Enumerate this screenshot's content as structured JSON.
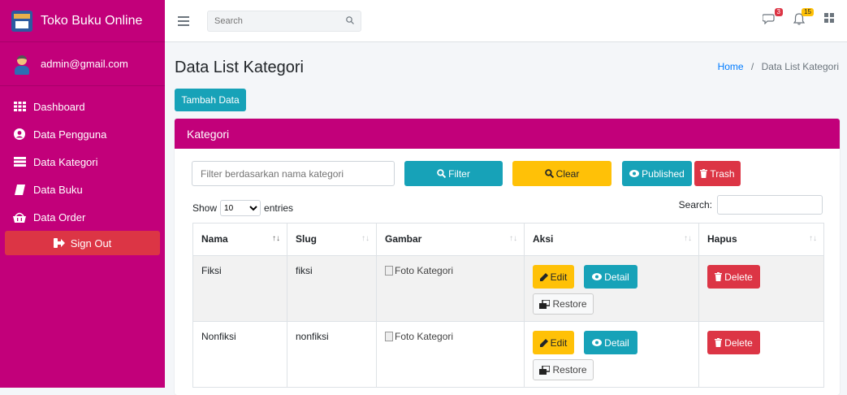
{
  "brand": {
    "name": "Toko Buku Online"
  },
  "user": {
    "email": "admin@gmail.com"
  },
  "sidebar": {
    "items": [
      {
        "label": "Dashboard",
        "icon": "grid-icon"
      },
      {
        "label": "Data Pengguna",
        "icon": "user-circle-icon"
      },
      {
        "label": "Data Kategori",
        "icon": "list-icon"
      },
      {
        "label": "Data Buku",
        "icon": "book-icon"
      },
      {
        "label": "Data Order",
        "icon": "cart-icon"
      }
    ],
    "signout_label": "Sign Out"
  },
  "topbar": {
    "search_placeholder": "Search",
    "messages_badge": "3",
    "notifications_badge": "15"
  },
  "page": {
    "title": "Data List Kategori",
    "breadcrumb": {
      "home": "Home",
      "separator": "/",
      "current": "Data List Kategori"
    },
    "add_button": "Tambah Data"
  },
  "card": {
    "title": "Kategori",
    "filter_placeholder": "Filter berdasarkan nama kategori",
    "filter_button": "Filter",
    "clear_button": "Clear",
    "published_button": "Published",
    "trash_button": "Trash",
    "show_label": "Show",
    "entries_value": "10",
    "entries_label": "entries",
    "search_label": "Search:"
  },
  "table": {
    "columns": [
      "Nama",
      "Slug",
      "Gambar",
      "Aksi",
      "Hapus"
    ],
    "rows": [
      {
        "nama": "Fiksi",
        "slug": "fiksi",
        "gambar_alt": "Foto Kategori"
      },
      {
        "nama": "Nonfiksi",
        "slug": "nonfiksi",
        "gambar_alt": "Foto Kategori"
      }
    ],
    "edit_label": "Edit",
    "detail_label": "Detail",
    "restore_label": "Restore",
    "delete_label": "Delete"
  },
  "colors": {
    "brand": "#c2007a",
    "info": "#17a2b8",
    "warning": "#ffc107",
    "danger": "#dc3545"
  }
}
